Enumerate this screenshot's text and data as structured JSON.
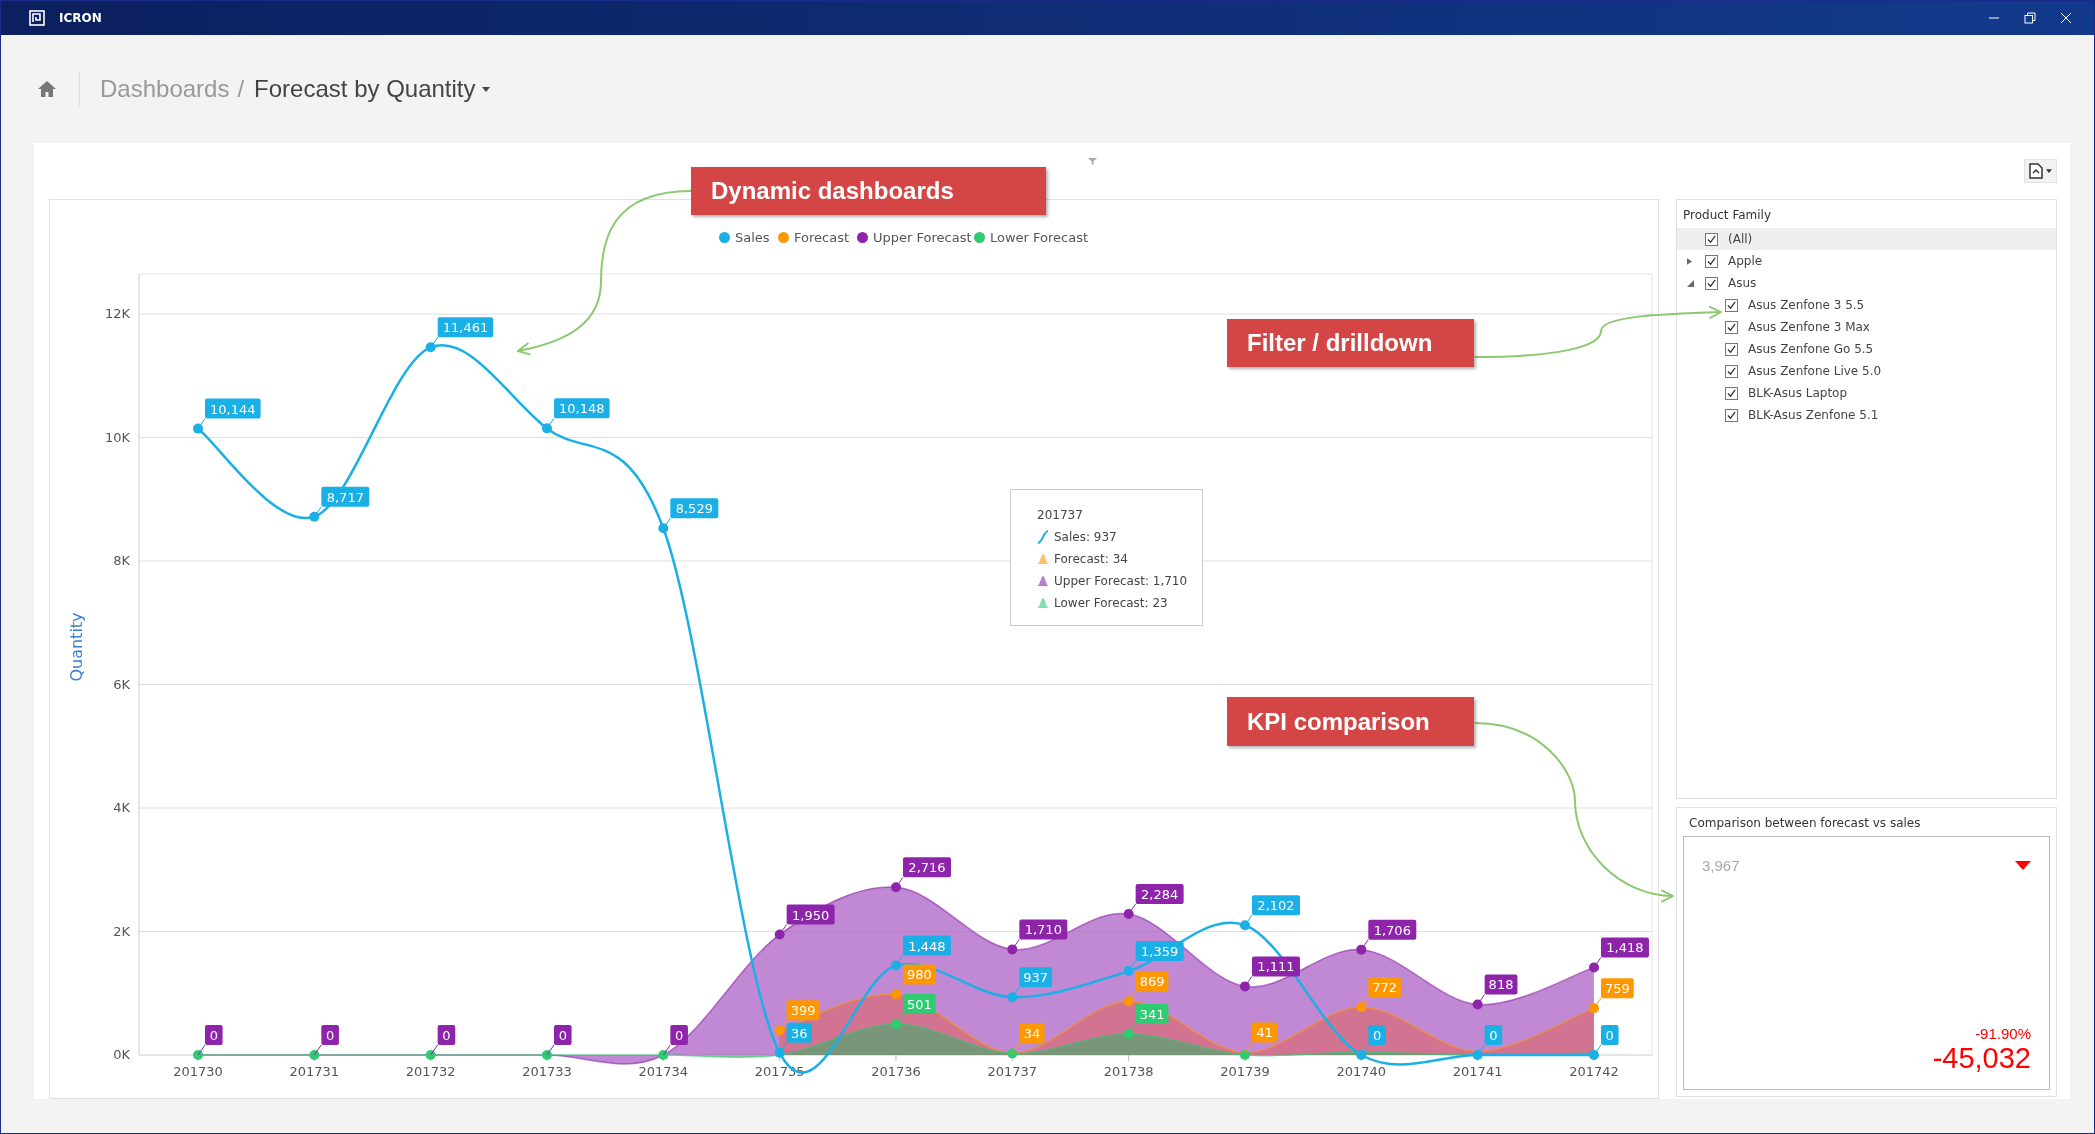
{
  "window": {
    "title": "ICRON"
  },
  "breadcrumb": {
    "parent": "Dashboards",
    "separator": "/",
    "current": "Forecast by Quantity"
  },
  "chart": {
    "chart_data": {
      "type": "area",
      "grid": true,
      "legend": true,
      "ylabel": "Quantity",
      "categories": [
        "201730",
        "201731",
        "201732",
        "201733",
        "201734",
        "201735",
        "201736",
        "201737",
        "201738",
        "201739",
        "201740",
        "201741",
        "201742"
      ],
      "series": [
        {
          "name": "Sales",
          "type": "line",
          "marker": "circle",
          "color": "#1ab0e6",
          "values": [
            10144,
            8717,
            11461,
            10148,
            8529,
            36,
            1448,
            937,
            1359,
            2102,
            0,
            0,
            0
          ]
        },
        {
          "name": "Forecast",
          "type": "area",
          "marker": "circle",
          "color": "#ff9800",
          "values": [
            null,
            null,
            null,
            null,
            null,
            399,
            980,
            34,
            869,
            41,
            772,
            60,
            759
          ]
        },
        {
          "name": "Upper Forecast",
          "type": "area",
          "marker": "circle",
          "color": "#8e24aa",
          "values": [
            0,
            0,
            0,
            0,
            0,
            1950,
            2716,
            1710,
            2284,
            1111,
            1706,
            818,
            1418
          ]
        },
        {
          "name": "Lower Forecast",
          "type": "area",
          "marker": "circle",
          "color": "#2ecc71",
          "values": [
            0,
            0,
            0,
            0,
            0,
            0,
            501,
            23,
            341,
            0,
            50,
            0,
            30
          ]
        }
      ],
      "ylim": [
        0,
        12000
      ],
      "yticks": [
        {
          "value": 0,
          "label": "0K"
        },
        {
          "value": 2000,
          "label": "2K"
        },
        {
          "value": 4000,
          "label": "4K"
        },
        {
          "value": 6000,
          "label": "6K"
        },
        {
          "value": 8000,
          "label": "8K"
        },
        {
          "value": 10000,
          "label": "10K"
        },
        {
          "value": 12000,
          "label": "12K"
        }
      ],
      "value_labels": [
        [
          "10,144",
          "8,717",
          "11,461",
          "10,148",
          "8,529",
          "36",
          "1,448",
          "937",
          "1,359",
          "2,102",
          "0",
          "0",
          "0"
        ],
        [
          null,
          null,
          null,
          null,
          null,
          "399",
          "980",
          "34",
          "869",
          "41",
          "772",
          null,
          "759"
        ],
        [
          "0",
          "0",
          "0",
          "0",
          "0",
          "1,950",
          "2,716",
          "1,710",
          "2,284",
          "1,111",
          "1,706",
          "818",
          "1,418"
        ],
        [
          null,
          null,
          null,
          null,
          null,
          null,
          "501",
          null,
          "341",
          null,
          null,
          null,
          null
        ]
      ]
    },
    "tooltip": {
      "title": "201737",
      "rows": [
        {
          "kind": "line",
          "text": "Sales: 937"
        },
        {
          "kind": "area",
          "text": "Forecast: 34"
        },
        {
          "kind": "area",
          "text": "Upper Forecast: 1,710"
        },
        {
          "kind": "area",
          "text": "Lower Forecast: 23"
        }
      ]
    }
  },
  "filter": {
    "title": "Product Family",
    "items": [
      {
        "label": "(All)",
        "checked": true,
        "selected": true
      },
      {
        "label": "Apple",
        "checked": true,
        "selected": false,
        "expanded": false
      },
      {
        "label": "Asus",
        "checked": true,
        "selected": false,
        "expanded": true,
        "children": [
          {
            "label": "Asus Zenfone 3 5.5",
            "checked": true,
            "selected": false
          },
          {
            "label": "Asus Zenfone 3 Max",
            "checked": true,
            "selected": false
          },
          {
            "label": "Asus Zenfone Go 5.5",
            "checked": true,
            "selected": false
          },
          {
            "label": "Asus Zenfone Live 5.0",
            "checked": true,
            "selected": false
          },
          {
            "label": "BLK-Asus Laptop",
            "checked": true,
            "selected": false
          },
          {
            "label": "BLK-Asus Zenfone 5.1",
            "checked": true,
            "selected": false
          }
        ]
      }
    ]
  },
  "kpi": {
    "title": "Comparison between forecast vs sales",
    "target": "3,967",
    "down": true,
    "percent": "-91.90%",
    "delta": "-45,032"
  },
  "callouts": [
    {
      "text": "Dynamic dashboards"
    },
    {
      "text": "Filter / drilldown"
    },
    {
      "text": "KPI comparison"
    }
  ]
}
